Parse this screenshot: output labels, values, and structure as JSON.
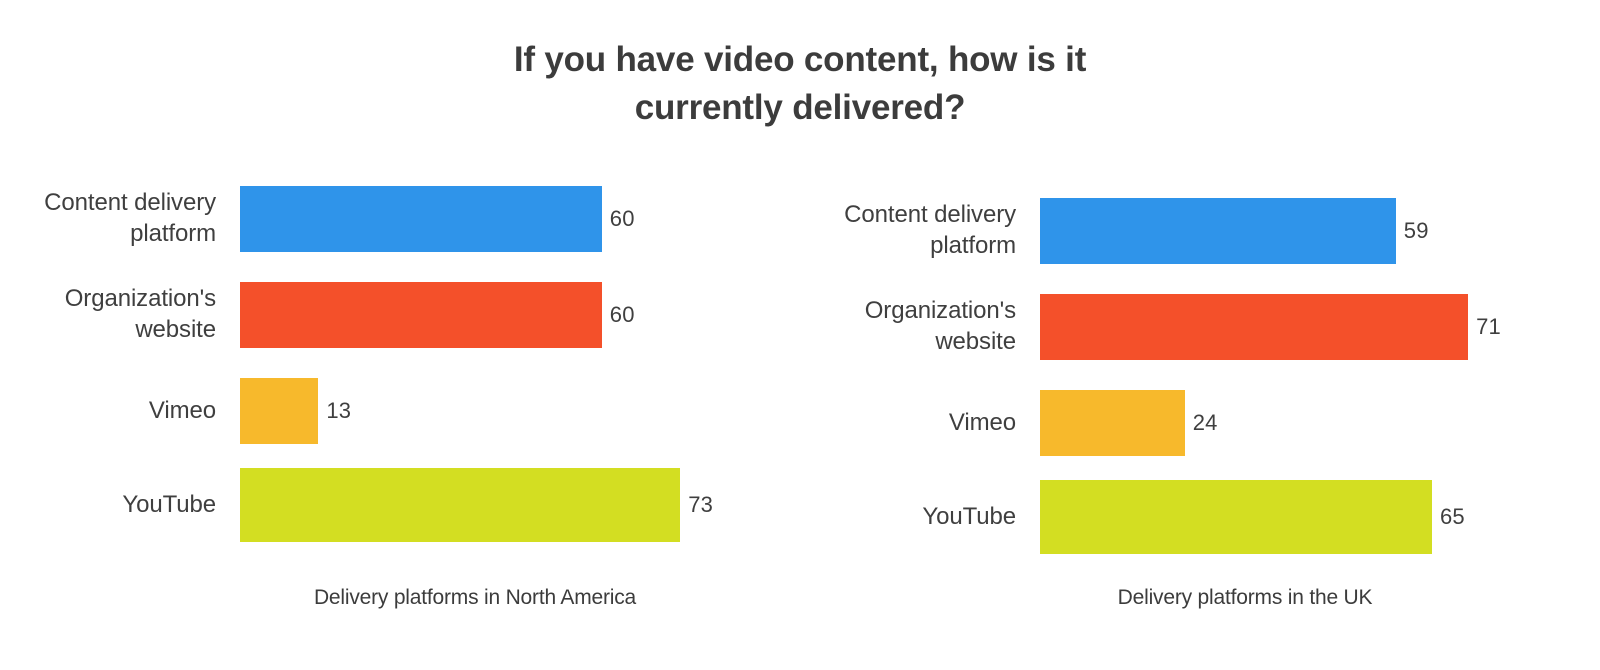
{
  "title": {
    "line1": "If you have video content, how is it",
    "line2": "currently delivered?",
    "full": "If you have video content, how is it currently delivered?"
  },
  "colors": {
    "blue": "#2f94ea",
    "red": "#f4502a",
    "amber": "#f7b92c",
    "lime": "#d3de22",
    "text": "#3f3f3f",
    "title": "#3c3c3c",
    "background": "#ffffff"
  },
  "panels": [
    {
      "caption": "Delivery platforms in North America",
      "categories": [
        "Content delivery platform",
        "Organization's website",
        "Vimeo",
        "YouTube"
      ],
      "values": [
        60,
        60,
        13,
        73
      ],
      "value_labels": [
        "60",
        "60",
        "13",
        "73"
      ],
      "colors": [
        "#2f94ea",
        "#f4502a",
        "#f7b92c",
        "#d3de22"
      ]
    },
    {
      "caption": "Delivery platforms in the UK",
      "categories": [
        "Content delivery platform",
        "Organization's website",
        "Vimeo",
        "YouTube"
      ],
      "values": [
        59,
        71,
        24,
        65
      ],
      "value_labels": [
        "59",
        "71",
        "24",
        "65"
      ],
      "colors": [
        "#2f94ea",
        "#f4502a",
        "#f7b92c",
        "#d3de22"
      ]
    }
  ],
  "chart_data": {
    "type": "bar",
    "orientation": "horizontal",
    "title": "If you have video content, how is it currently delivered?",
    "xlabel": "",
    "ylabel": "",
    "grid": false,
    "legend": "none",
    "xlim": [
      0,
      73
    ],
    "panels": [
      {
        "subtitle": "Delivery platforms in North America",
        "categories": [
          "Content delivery platform",
          "Organization's website",
          "Vimeo",
          "YouTube"
        ],
        "series": [
          {
            "name": "Delivery platforms in North America",
            "values": [
              60,
              60,
              13,
              73
            ]
          }
        ]
      },
      {
        "subtitle": "Delivery platforms in the UK",
        "categories": [
          "Content delivery platform",
          "Organization's website",
          "Vimeo",
          "YouTube"
        ],
        "series": [
          {
            "name": "Delivery platforms in the UK",
            "values": [
              59,
              71,
              24,
              65
            ]
          }
        ]
      }
    ]
  }
}
